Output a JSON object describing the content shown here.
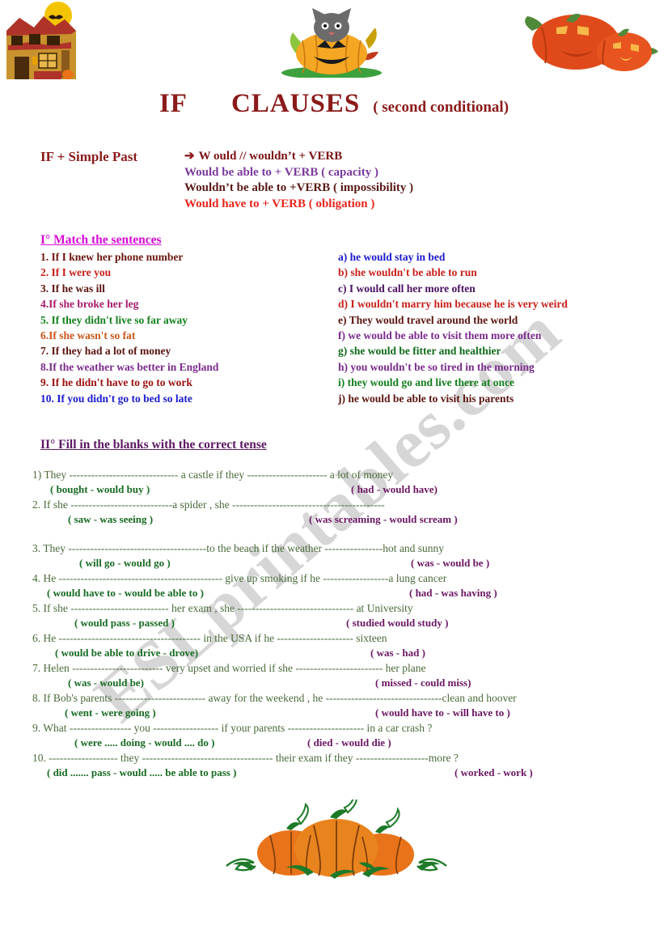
{
  "title": {
    "if": "IF",
    "clauses": "CLAUSES",
    "subtitle": "( second conditional)"
  },
  "formula": {
    "heading": "IF + Simple Past",
    "arrow": "➔",
    "lines": [
      "W ould // wouldn’t + VERB",
      "Would be able to + VERB ( capacity )",
      "Wouldn’t be able to +VERB ( impossibility )",
      "Would have to + VERB ( obligation )"
    ]
  },
  "section1": {
    "heading": "I° Match the sentences",
    "left": [
      "1. If I knew her phone number",
      "2. If I were you",
      "3. If  he was ill",
      "4.If she broke her leg",
      "5. If they didn't live so far away",
      "6.If she wasn't so fat",
      "7. If they had a lot of money",
      "8.If the weather was  better in England",
      "9. If  he didn't have to  go  to  work",
      "10. If you didn't go to  bed so late"
    ],
    "right": [
      "a) he  would stay in bed",
      "b) she  wouldn't  be able to run",
      "c) I would call her more often",
      "d) I wouldn't marry him because he is very weird",
      "e) They would travel around the world",
      "f) we would be able to visit them more often",
      "g) she would be fitter and healthier",
      "h) you wouldn't  be so tired in the morning",
      "i)  they would go and live there at once",
      "j)  he would be able to visit his parents"
    ]
  },
  "section2": {
    "heading": "II° Fill in the blanks with the correct tense",
    "items": [
      {
        "sentence": "1)  They ------------------------------  a castle  if   they ---------------------- a lot of money",
        "option1": "( bought  -   would buy )",
        "option2": "( had -      would have)"
      },
      {
        "sentence": "2. If  she ----------------------------a spider  , she  ------------------------------------------",
        "option1": "(  saw -   was seeing )",
        "option2": "( was screaming  -   would scream )"
      },
      {
        "sentence": "3. They --------------------------------------to the beach   if the weather  ----------------hot and sunny",
        "option1": "( will  go   -    would  go )",
        "option2": "( was -    would be )"
      },
      {
        "sentence": "4.  He --------------------------------------------- give  up  smoking   if he  ------------------a lung cancer",
        "option1": "( would have to -   would  be able to )",
        "option2": "( had -  was having )"
      },
      {
        "sentence": "5. If    she  --------------------------- her exam ,  she  --------------------------------      at  University",
        "option1": "( would pass      -      passed )",
        "option2": "( studied       would study  )"
      },
      {
        "sentence": "6. He --------------------------------------- in the USA  if  he  --------------------- sixteen",
        "option1": "( would be  able to  drive   -    drove)",
        "option2": "( was      -      had )"
      },
      {
        "sentence": "7.  Helen  ------------------------- very upset and worried  if  she ------------------------ her plane",
        "option1": "( was  -    would  be)",
        "option2": "( missed -  could miss)"
      },
      {
        "sentence": "8.  If  Bob's parents ------------------------- away for the weekend , he --------------------------------clean and hoover",
        "option1": "(    went -    were  going )",
        "option2": "( would have to   -    will  have to )"
      },
      {
        "sentence": "9.  What ----------------- you  ------------------ if your parents   ---------------------  in a car crash ?",
        "option1": "( were ..... doing   -     would .... do  )",
        "option2": "(  died  -    would die  )"
      },
      {
        "sentence": "10.  ------------------- they ------------------------------------  their  exam if they --------------------more ?",
        "option1": "(  did ....... pass  -     would ..... be able to pass  )",
        "option2": "( worked -     work )"
      }
    ]
  },
  "watermark": {
    "text": "ESLprintables.com"
  },
  "clipart": {
    "house": "haunted-house-with-moon-and-bat",
    "cat_pumpkin": "black-cat-in-jack-o-lantern",
    "two_pumpkins": "two-carved-orange-pumpkins",
    "bottom_pumpkins": "three-pumpkins-with-vines"
  },
  "colors": {
    "title": "#8b1a1a",
    "heading1": "#d60ad6",
    "heading2": "#5c1a63",
    "sentence": "#4a6a3a",
    "option_green": "#176b22",
    "option_purple": "#6b1663",
    "pumpkin_orange": "#e8731a",
    "leaf_green": "#1d7a28"
  }
}
